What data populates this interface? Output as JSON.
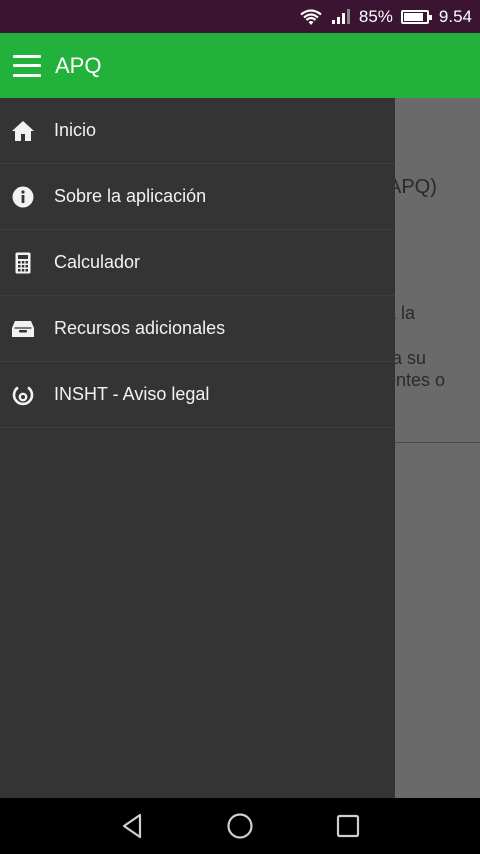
{
  "status_bar": {
    "battery_percent": "85%",
    "battery_level": 0.85,
    "time": "9.54",
    "icons": [
      "wifi-icon",
      "signal-icon",
      "battery-icon"
    ]
  },
  "app_bar": {
    "title": "APQ",
    "menu_icon": "hamburger-menu-icon",
    "color": "#22b13a"
  },
  "background": {
    "text_fragments": [
      "APQ)",
      "a la",
      "ra su",
      "entes o"
    ]
  },
  "drawer": {
    "items": [
      {
        "label": "Inicio",
        "icon": "home-icon"
      },
      {
        "label": "Sobre la aplicación",
        "icon": "info-icon"
      },
      {
        "label": "Calculador",
        "icon": "calculator-icon"
      },
      {
        "label": "Recursos adicionales",
        "icon": "inbox-icon"
      },
      {
        "label": "INSHT - Aviso legal",
        "icon": "power-icon"
      }
    ]
  },
  "nav_bar": {
    "buttons": [
      "back-icon",
      "home-circle-icon",
      "recents-icon"
    ]
  }
}
